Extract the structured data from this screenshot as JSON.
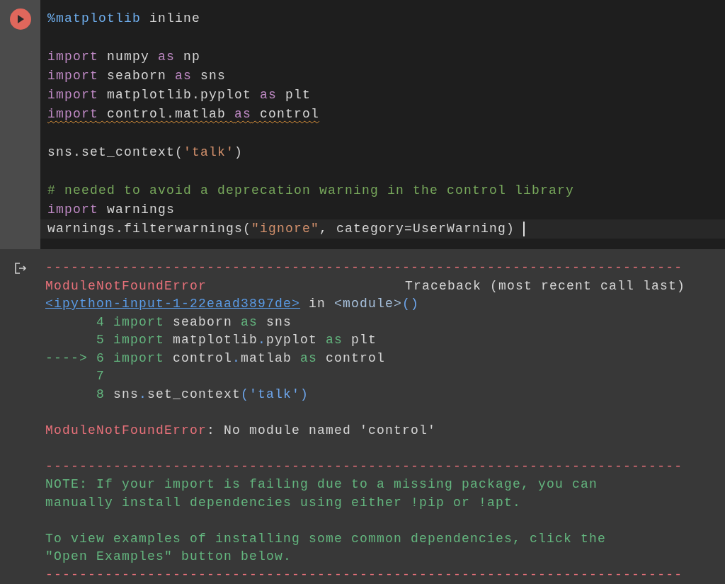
{
  "code_cell": {
    "blocks": [
      {
        "lines": [
          {
            "squiggle": false,
            "cursor": false,
            "tokens": [
              {
                "text": "%matplotlib",
                "kind": "magic"
              },
              {
                "text": " inline",
                "kind": "plain"
              }
            ]
          }
        ]
      },
      {
        "lines": [
          {
            "squiggle": false,
            "cursor": false,
            "tokens": [
              {
                "text": "import",
                "kind": "keyword"
              },
              {
                "text": " numpy ",
                "kind": "plain"
              },
              {
                "text": "as",
                "kind": "keyword"
              },
              {
                "text": " np",
                "kind": "plain"
              }
            ]
          },
          {
            "squiggle": false,
            "cursor": false,
            "tokens": [
              {
                "text": "import",
                "kind": "keyword"
              },
              {
                "text": " seaborn ",
                "kind": "plain"
              },
              {
                "text": "as",
                "kind": "keyword"
              },
              {
                "text": " sns",
                "kind": "plain"
              }
            ]
          },
          {
            "squiggle": false,
            "cursor": false,
            "tokens": [
              {
                "text": "import",
                "kind": "keyword"
              },
              {
                "text": " matplotlib.pyplot ",
                "kind": "plain"
              },
              {
                "text": "as",
                "kind": "keyword"
              },
              {
                "text": " plt",
                "kind": "plain"
              }
            ]
          },
          {
            "squiggle": true,
            "cursor": false,
            "tokens": [
              {
                "text": "import",
                "kind": "keyword"
              },
              {
                "text": " control.matlab ",
                "kind": "plain"
              },
              {
                "text": "as",
                "kind": "keyword"
              },
              {
                "text": " control",
                "kind": "plain"
              }
            ]
          }
        ]
      },
      {
        "lines": [
          {
            "squiggle": false,
            "cursor": false,
            "tokens": [
              {
                "text": "sns.set_context(",
                "kind": "plain"
              },
              {
                "text": "'talk'",
                "kind": "string"
              },
              {
                "text": ")",
                "kind": "plain"
              }
            ]
          }
        ]
      },
      {
        "lines": [
          {
            "squiggle": false,
            "cursor": false,
            "tokens": [
              {
                "text": "# needed to avoid a deprecation warning in the control library",
                "kind": "comment"
              }
            ]
          },
          {
            "squiggle": false,
            "cursor": false,
            "tokens": [
              {
                "text": "import",
                "kind": "keyword"
              },
              {
                "text": " warnings",
                "kind": "plain"
              }
            ]
          },
          {
            "squiggle": false,
            "cursor": true,
            "tokens": [
              {
                "text": "warnings.filterwarnings(",
                "kind": "plain"
              },
              {
                "text": "\"ignore\"",
                "kind": "string"
              },
              {
                "text": ", category=UserWarning) ",
                "kind": "plain"
              }
            ]
          }
        ]
      }
    ]
  },
  "output": {
    "blocks": [
      {
        "lines": [
          {
            "tokens": [
              {
                "text": "---------------------------------------------------------------------------",
                "kind": "error"
              }
            ]
          },
          {
            "tokens": [
              {
                "text": "ModuleNotFoundError",
                "kind": "error"
              }
            ],
            "right": "Traceback (most recent call last)"
          },
          {
            "tokens": [
              {
                "text": "<ipython-input-1-22eaad3897de>",
                "kind": "link"
              },
              {
                "text": " in ",
                "kind": "plain"
              },
              {
                "text": "<module>",
                "kind": "name"
              },
              {
                "text": "()",
                "kind": "blue"
              }
            ]
          },
          {
            "tokens": [
              {
                "text": "      4 import",
                "kind": "green"
              },
              {
                "text": " seaborn ",
                "kind": "plain"
              },
              {
                "text": "as",
                "kind": "green"
              },
              {
                "text": " sns",
                "kind": "plain"
              }
            ]
          },
          {
            "tokens": [
              {
                "text": "      5 import",
                "kind": "green"
              },
              {
                "text": " matplotlib",
                "kind": "plain"
              },
              {
                "text": ".",
                "kind": "blue"
              },
              {
                "text": "pyplot ",
                "kind": "plain"
              },
              {
                "text": "as",
                "kind": "green"
              },
              {
                "text": " plt",
                "kind": "plain"
              }
            ]
          },
          {
            "tokens": [
              {
                "text": "----> 6 import",
                "kind": "green"
              },
              {
                "text": " control",
                "kind": "plain"
              },
              {
                "text": ".",
                "kind": "blue"
              },
              {
                "text": "matlab ",
                "kind": "plain"
              },
              {
                "text": "as",
                "kind": "green"
              },
              {
                "text": " control",
                "kind": "plain"
              }
            ]
          },
          {
            "tokens": [
              {
                "text": "      7",
                "kind": "green"
              }
            ]
          },
          {
            "tokens": [
              {
                "text": "      8",
                "kind": "green"
              },
              {
                "text": " sns",
                "kind": "plain"
              },
              {
                "text": ".",
                "kind": "blue"
              },
              {
                "text": "set_context",
                "kind": "plain"
              },
              {
                "text": "(",
                "kind": "blue"
              },
              {
                "text": "'talk'",
                "kind": "blue"
              },
              {
                "text": ")",
                "kind": "blue"
              }
            ]
          }
        ]
      },
      {
        "lines": [
          {
            "tokens": [
              {
                "text": "ModuleNotFoundError",
                "kind": "error"
              },
              {
                "text": ": No module named 'control'",
                "kind": "plain"
              }
            ]
          }
        ]
      },
      {
        "lines": [
          {
            "tokens": [
              {
                "text": "---------------------------------------------------------------------------",
                "kind": "error"
              }
            ]
          },
          {
            "tokens": [
              {
                "text": "NOTE: If your import is failing due to a missing package, you can",
                "kind": "green"
              }
            ]
          },
          {
            "tokens": [
              {
                "text": "manually install dependencies using either !pip or !apt.",
                "kind": "green"
              }
            ]
          }
        ]
      },
      {
        "lines": [
          {
            "tokens": [
              {
                "text": "To view examples of installing some common dependencies, click the",
                "kind": "green"
              }
            ]
          },
          {
            "tokens": [
              {
                "text": "\"Open Examples\" button below.",
                "kind": "green"
              }
            ]
          },
          {
            "tokens": [
              {
                "text": "---------------------------------------------------------------------------",
                "kind": "error"
              }
            ]
          }
        ]
      }
    ]
  }
}
